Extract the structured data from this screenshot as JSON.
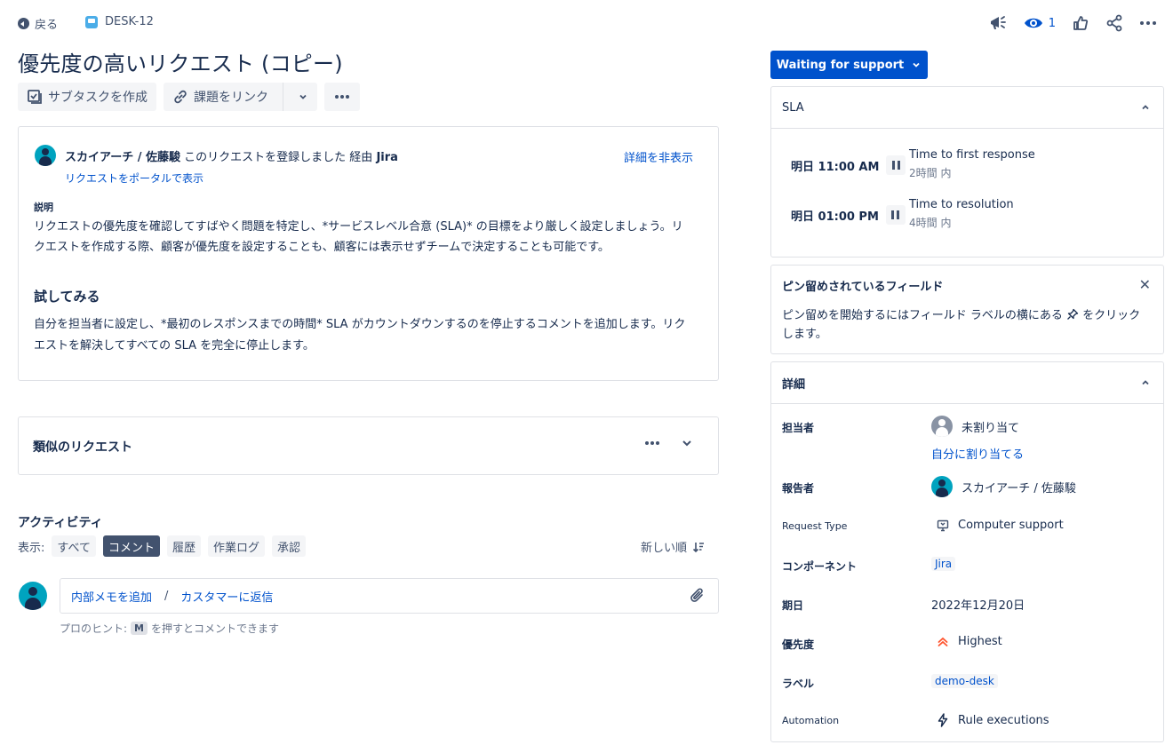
{
  "nav": {
    "back_label": "戻る",
    "issue_key": "DESK-12"
  },
  "top_actions": {
    "watch_count": "1"
  },
  "issue": {
    "title": "優先度の高いリクエスト (コピー)"
  },
  "toolbar": {
    "create_subtask": "サブタスクを作成",
    "link_issue": "課題をリンク"
  },
  "request": {
    "author": "スカイアーチ / 佐藤駿",
    "action_text": "このリクエストを登録しました 経由",
    "via": "Jira",
    "portal_link": "リクエストをポータルで表示",
    "hide_details": "詳細を非表示",
    "description_label": "説明",
    "description": "リクエストの優先度を確認してすばやく問題を特定し、*サービスレベル合意 (SLA)* の目標をより厳しく設定しましょう。リクエストを作成する際、顧客が優先度を設定することも、顧客には表示せずチームで決定することも可能です。",
    "try_heading": "試してみる",
    "try_text": "自分を担当者に設定し、*最初のレスポンスまでの時間* SLA がカウントダウンするのを停止するコメントを追加します。リクエストを解決してすべての SLA を完全に停止します。"
  },
  "similar": {
    "title": "類似のリクエスト"
  },
  "activity": {
    "title": "アクティビティ",
    "show_label": "表示:",
    "filters": [
      "すべて",
      "コメント",
      "履歴",
      "作業ログ",
      "承認"
    ],
    "sort_label": "新しい順",
    "add_internal_note": "内部メモを追加",
    "separator": "/",
    "reply_customer": "カスタマーに返信",
    "protip_prefix": "プロのヒント:",
    "protip_key": "M",
    "protip_suffix": "を押すとコメントできます"
  },
  "status": {
    "label": "Waiting for support"
  },
  "sla": {
    "title": "SLA",
    "items": [
      {
        "due": "明日 11:00 AM",
        "name": "Time to first response",
        "remaining": "2時間 内"
      },
      {
        "due": "明日 01:00 PM",
        "name": "Time to resolution",
        "remaining": "4時間 内"
      }
    ]
  },
  "pinned": {
    "title": "ピン留めされているフィールド",
    "text_before": "ピン留めを開始するにはフィールド ラベルの横にある",
    "text_after": "をクリックします。"
  },
  "details": {
    "title": "詳細",
    "assignee_label": "担当者",
    "assignee_value": "未割り当て",
    "assign_to_me": "自分に割り当てる",
    "reporter_label": "報告者",
    "reporter_value": "スカイアーチ / 佐藤駿",
    "request_type_label": "Request Type",
    "request_type_value": "Computer support",
    "component_label": "コンポーネント",
    "component_value": "Jira",
    "due_label": "期日",
    "due_value": "2022年12月20日",
    "priority_label": "優先度",
    "priority_value": "Highest",
    "label_label": "ラベル",
    "label_value": "demo-desk",
    "automation_label": "Automation",
    "automation_value": "Rule executions"
  },
  "colors": {
    "primary": "#0052cc",
    "text": "#172b4d",
    "muted": "#42526e",
    "priority_highest": "#ff5630"
  }
}
